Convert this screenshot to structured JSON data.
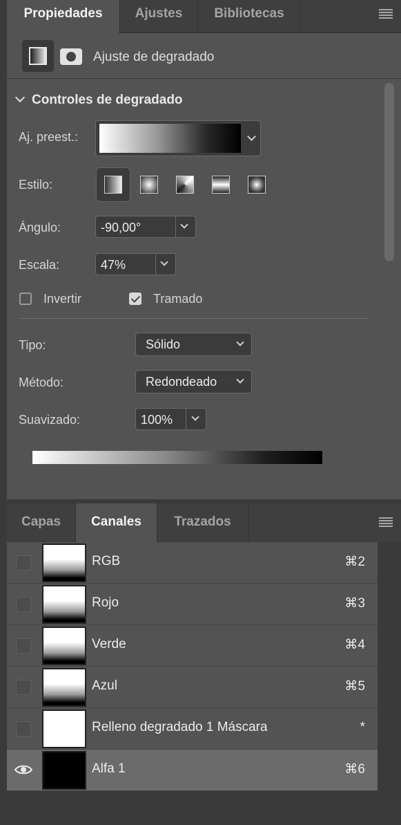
{
  "properties_panel": {
    "tabs": [
      {
        "label": "Propiedades",
        "active": true
      },
      {
        "label": "Ajustes",
        "active": false
      },
      {
        "label": "Bibliotecas",
        "active": false
      }
    ],
    "header_title": "Ajuste de degradado",
    "section_title": "Controles de degradado",
    "preset_label": "Aj. preest.:",
    "style_label": "Estilo:",
    "style_options": [
      "linear-gradient-icon",
      "radial-gradient-icon",
      "angle-gradient-icon",
      "reflected-gradient-icon",
      "diamond-gradient-icon"
    ],
    "style_selected": "linear-gradient-icon",
    "angle_label": "Ángulo:",
    "angle_value": "-90,00°",
    "scale_label": "Escala:",
    "scale_value": "47%",
    "invert_label": "Invertir",
    "invert_checked": false,
    "dither_label": "Tramado",
    "dither_checked": true,
    "type_label": "Tipo:",
    "type_value": "Sólido",
    "method_label": "Método:",
    "method_value": "Redondeado",
    "smoothness_label": "Suavizado:",
    "smoothness_value": "100%"
  },
  "channels_panel": {
    "tabs": [
      {
        "label": "Capas",
        "active": false
      },
      {
        "label": "Canales",
        "active": true
      },
      {
        "label": "Trazados",
        "active": false
      }
    ],
    "channels": [
      {
        "name": "RGB",
        "shortcut": "⌘2",
        "visible": false,
        "selected": false,
        "thumb": "gradient"
      },
      {
        "name": "Rojo",
        "shortcut": "⌘3",
        "visible": false,
        "selected": false,
        "thumb": "gradient"
      },
      {
        "name": "Verde",
        "shortcut": "⌘4",
        "visible": false,
        "selected": false,
        "thumb": "gradient"
      },
      {
        "name": "Azul",
        "shortcut": "⌘5",
        "visible": false,
        "selected": false,
        "thumb": "gradient"
      },
      {
        "name": "Relleno degradado 1 Máscara",
        "shortcut": "*",
        "visible": false,
        "selected": false,
        "thumb": "white"
      },
      {
        "name": "Alfa 1",
        "shortcut": "⌘6",
        "visible": true,
        "selected": true,
        "thumb": "black"
      }
    ]
  }
}
